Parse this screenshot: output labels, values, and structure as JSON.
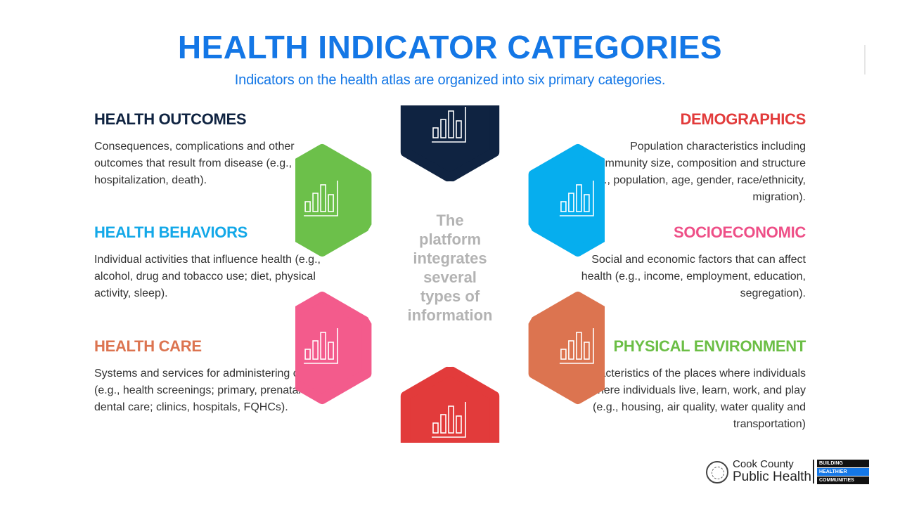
{
  "header": {
    "title": "HEALTH INDICATOR CATEGORIES",
    "subtitle": "Indicators on the health atlas are organized into six primary categories."
  },
  "center_text": [
    "The",
    "platform",
    "integrates",
    "several",
    "types of",
    "information"
  ],
  "categories": {
    "health_outcomes": {
      "title": "HEALTH OUTCOMES",
      "description": "Consequences, complications and other outcomes that result from disease (e.g., injury, hospitalization, death).",
      "color": "#0f2341"
    },
    "health_behaviors": {
      "title": "HEALTH BEHAVIORS",
      "description": "Individual activities that influence health (e.g., alcohol, drug and tobacco use; diet, physical activity, sleep).",
      "color": "#13a8e8"
    },
    "health_care": {
      "title": "HEALTH CARE",
      "description": "Systems and services for administering care (e.g., health screenings; primary, prenatal and dental care; clinics, hospitals, FQHCs).",
      "color": "#dc7450"
    },
    "demographics": {
      "title": "DEMOGRAPHICS",
      "description": "Population characteristics including community size, composition and structure (e.g., population, age, gender, race/ethnicity, migration).",
      "color": "#e23b3b"
    },
    "socioeconomic": {
      "title": "SOCIOECONOMIC",
      "description": "Social and economic factors that can affect health (e.g., income, employment, education, segregation).",
      "color": "#ee4f87"
    },
    "physical_environment": {
      "title": "PHYSICAL ENVIRONMENT",
      "description": "Characteristics of the places where individuals where individuals live, learn, work, and play (e.g., housing, air quality, water quality and transportation)",
      "color": "#6bbe45"
    }
  },
  "hexagons": [
    {
      "position": "top",
      "color": "#0f2341",
      "icon": "bar-chart-icon"
    },
    {
      "position": "upper-right",
      "color": "#06aeee",
      "icon": "bar-chart-icon"
    },
    {
      "position": "lower-right",
      "color": "#dc7450",
      "icon": "bar-chart-icon"
    },
    {
      "position": "bottom",
      "color": "#e23b3b",
      "icon": "bar-chart-icon"
    },
    {
      "position": "lower-left",
      "color": "#f35b8c",
      "icon": "bar-chart-icon"
    },
    {
      "position": "upper-left",
      "color": "#6cc04a",
      "icon": "bar-chart-icon"
    }
  ],
  "logo": {
    "line1": "Cook County",
    "line2": "Public Health",
    "badge": [
      "BUILDING",
      "HEALTHIER",
      "COMMUNITIES"
    ]
  }
}
